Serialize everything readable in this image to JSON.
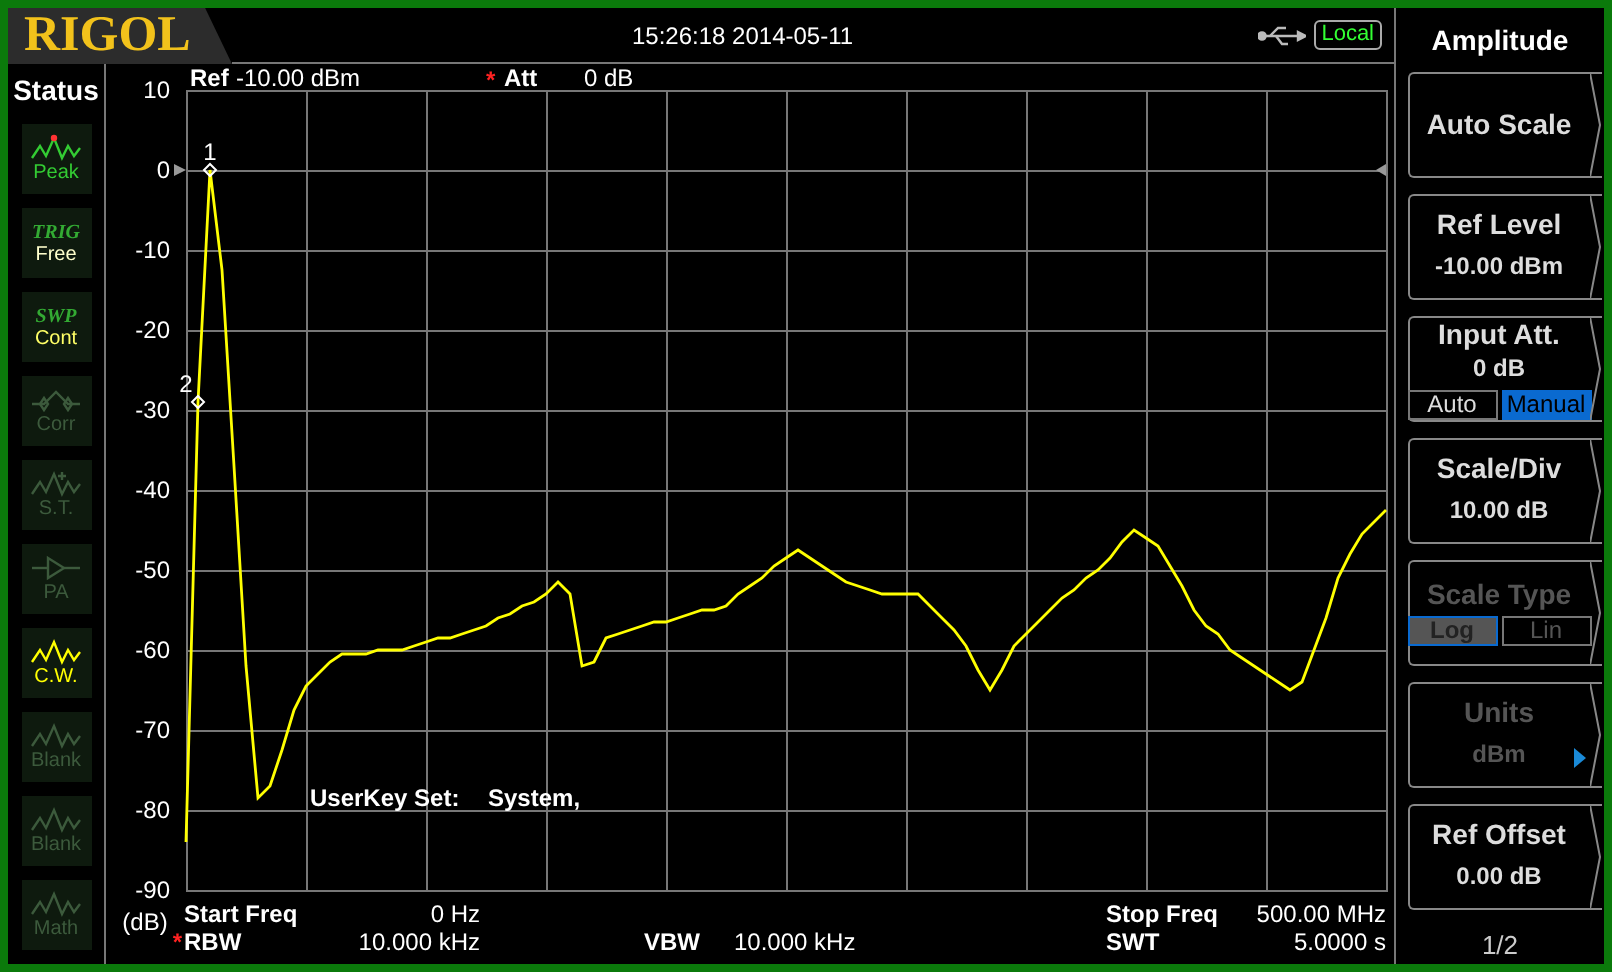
{
  "header": {
    "logo": "RIGOL",
    "datetime": "15:26:18 2014-05-11",
    "remote_status": "Local"
  },
  "status_panel": {
    "title": "Status",
    "items": [
      {
        "kind": "peak",
        "label": "Peak",
        "color": "#33cc33"
      },
      {
        "kind": "mode",
        "header": "TRIG",
        "label": "Free",
        "color": "#ffffcc"
      },
      {
        "kind": "mode",
        "header": "SWP",
        "label": "Cont",
        "color": "#ffff66"
      },
      {
        "kind": "correction",
        "label": "Corr",
        "color": "#3c5a3c"
      },
      {
        "kind": "spectrum",
        "label": "S.T.",
        "color": "#3c5a3c"
      },
      {
        "kind": "amplifier",
        "label": "PA",
        "color": "#3c5a3c"
      },
      {
        "kind": "wave",
        "label": "C.W.",
        "color": "#ffff00"
      },
      {
        "kind": "wave",
        "label": "Blank",
        "color": "#3c5a3c"
      },
      {
        "kind": "wave",
        "label": "Blank",
        "color": "#3c5a3c"
      },
      {
        "kind": "wave",
        "label": "Math",
        "color": "#3c5a3c"
      }
    ]
  },
  "display": {
    "ref": {
      "label": "Ref",
      "value": "-10.00 dBm"
    },
    "att": {
      "flag": "*",
      "label": "Att",
      "value": "0 dB"
    },
    "userkey": {
      "label": "UserKey Set:",
      "value": "System,"
    },
    "chart_data": {
      "type": "line",
      "ylabel": "(dB)",
      "ylim": [
        -90,
        10
      ],
      "yticks": [
        10,
        0,
        -10,
        -20,
        -30,
        -40,
        -50,
        -60,
        -70,
        -80,
        -90
      ],
      "categories": [
        null,
        null,
        null,
        null,
        null,
        null,
        null,
        null,
        null,
        null,
        null,
        null,
        null,
        null,
        null,
        null,
        null,
        null,
        null,
        null,
        null,
        null,
        null,
        null,
        null,
        null,
        null,
        null,
        null,
        null,
        null,
        null,
        null,
        null,
        null,
        null,
        null,
        null,
        null,
        null,
        null,
        null,
        null,
        null,
        null,
        null,
        null,
        null,
        null,
        null,
        null,
        null,
        null,
        null,
        null,
        null,
        null,
        null,
        null,
        null,
        null,
        null,
        null,
        null,
        null,
        null,
        null,
        null,
        null,
        null,
        null,
        null,
        null,
        null,
        null,
        null,
        null,
        null,
        null,
        null,
        null,
        null,
        null,
        null,
        null,
        null,
        null,
        null,
        null,
        null,
        null,
        null,
        null,
        null,
        null,
        null,
        null,
        null,
        null,
        null,
        null
      ],
      "series": [
        {
          "color": "#ffff00",
          "values": [
            -84,
            -29,
            0,
            -12.5,
            -37,
            -62,
            -78.5,
            -77,
            -72.5,
            -67.5,
            -64.5,
            -63,
            -61.5,
            -60.5,
            -60.5,
            -60.5,
            -60,
            -60,
            -60,
            -59.5,
            -59,
            -58.5,
            -58.5,
            -58,
            -57.5,
            -57,
            -56,
            -55.5,
            -54.5,
            -54,
            -53,
            -51.5,
            -53,
            -62,
            -61.5,
            -58.5,
            -58,
            -57.5,
            -57,
            -56.5,
            -56.5,
            -56,
            -55.5,
            -55,
            -55,
            -54.5,
            -53,
            -52,
            -51,
            -49.5,
            -48.5,
            -47.5,
            -48.5,
            -49.5,
            -50.5,
            -51.5,
            -52,
            -52.5,
            -53,
            -53,
            -53,
            -53,
            -54.5,
            -56,
            -57.5,
            -59.5,
            -62.5,
            -65,
            -62.5,
            -59.5,
            -58,
            -56.5,
            -55,
            -53.5,
            -52.5,
            -51,
            -50,
            -48.5,
            -46.5,
            -45,
            -46,
            -47,
            -49.5,
            -52,
            -55,
            -57,
            -58,
            -60,
            -61,
            -62,
            -63,
            -64,
            -65,
            -64,
            -60,
            -56,
            -51,
            -48,
            -45.5,
            -44,
            -42.5
          ]
        }
      ],
      "grid": true,
      "annotations": [
        {
          "y": 0,
          "text": "1"
        },
        {
          "y": -29,
          "text": "2"
        }
      ]
    },
    "footer": {
      "start_freq": {
        "label": "Start Freq",
        "value": "0 Hz"
      },
      "stop_freq": {
        "label": "Stop Freq",
        "value": "500.00 MHz"
      },
      "rbw": {
        "flag": "*",
        "label": "RBW",
        "value": "10.000 kHz"
      },
      "vbw": {
        "label": "VBW",
        "value": "10.000 kHz"
      },
      "swt": {
        "label": "SWT",
        "value": "5.0000 s"
      }
    }
  },
  "menu": {
    "title": "Amplitude",
    "items": [
      {
        "kind": "simple",
        "label": "Auto Scale",
        "disabled": false
      },
      {
        "kind": "value",
        "label": "Ref Level",
        "value": "-10.00 dBm",
        "disabled": false
      },
      {
        "kind": "toggle",
        "label": "Input Att.",
        "value": "0 dB",
        "disabled": false,
        "options": [
          {
            "label": "Auto",
            "selected": false
          },
          {
            "label": "Manual",
            "selected": true
          }
        ]
      },
      {
        "kind": "value",
        "label": "Scale/Div",
        "value": "10.00 dB",
        "disabled": false
      },
      {
        "kind": "toggle",
        "label": "Scale Type",
        "disabled": true,
        "options": [
          {
            "label": "Log",
            "selected": true
          },
          {
            "label": "Lin",
            "selected": false
          }
        ]
      },
      {
        "kind": "submenu",
        "label": "Units",
        "value": "dBm",
        "disabled": true
      },
      {
        "kind": "value",
        "label": "Ref Offset",
        "value": "0.00 dB",
        "disabled": false
      }
    ],
    "page": "1/2"
  }
}
